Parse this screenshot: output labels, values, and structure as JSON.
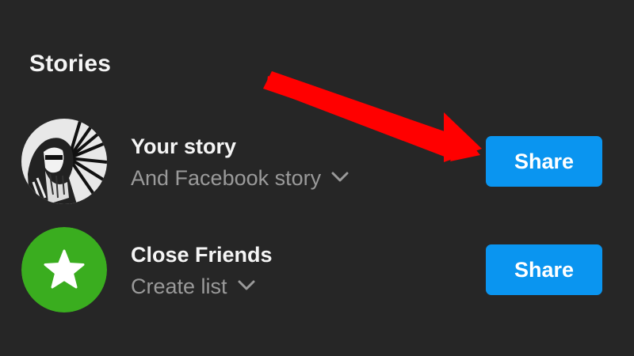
{
  "section": {
    "title": "Stories"
  },
  "rows": [
    {
      "title": "Your story",
      "subtitle": "And Facebook story",
      "button": "Share",
      "avatar_icon": "profile-photo-avatar"
    },
    {
      "title": "Close Friends",
      "subtitle": "Create list",
      "button": "Share",
      "avatar_icon": "star-icon",
      "avatar_color": "#3aad1f"
    }
  ],
  "colors": {
    "background": "#262626",
    "button": "#0a95f0",
    "annotation_arrow": "#ff0000"
  }
}
